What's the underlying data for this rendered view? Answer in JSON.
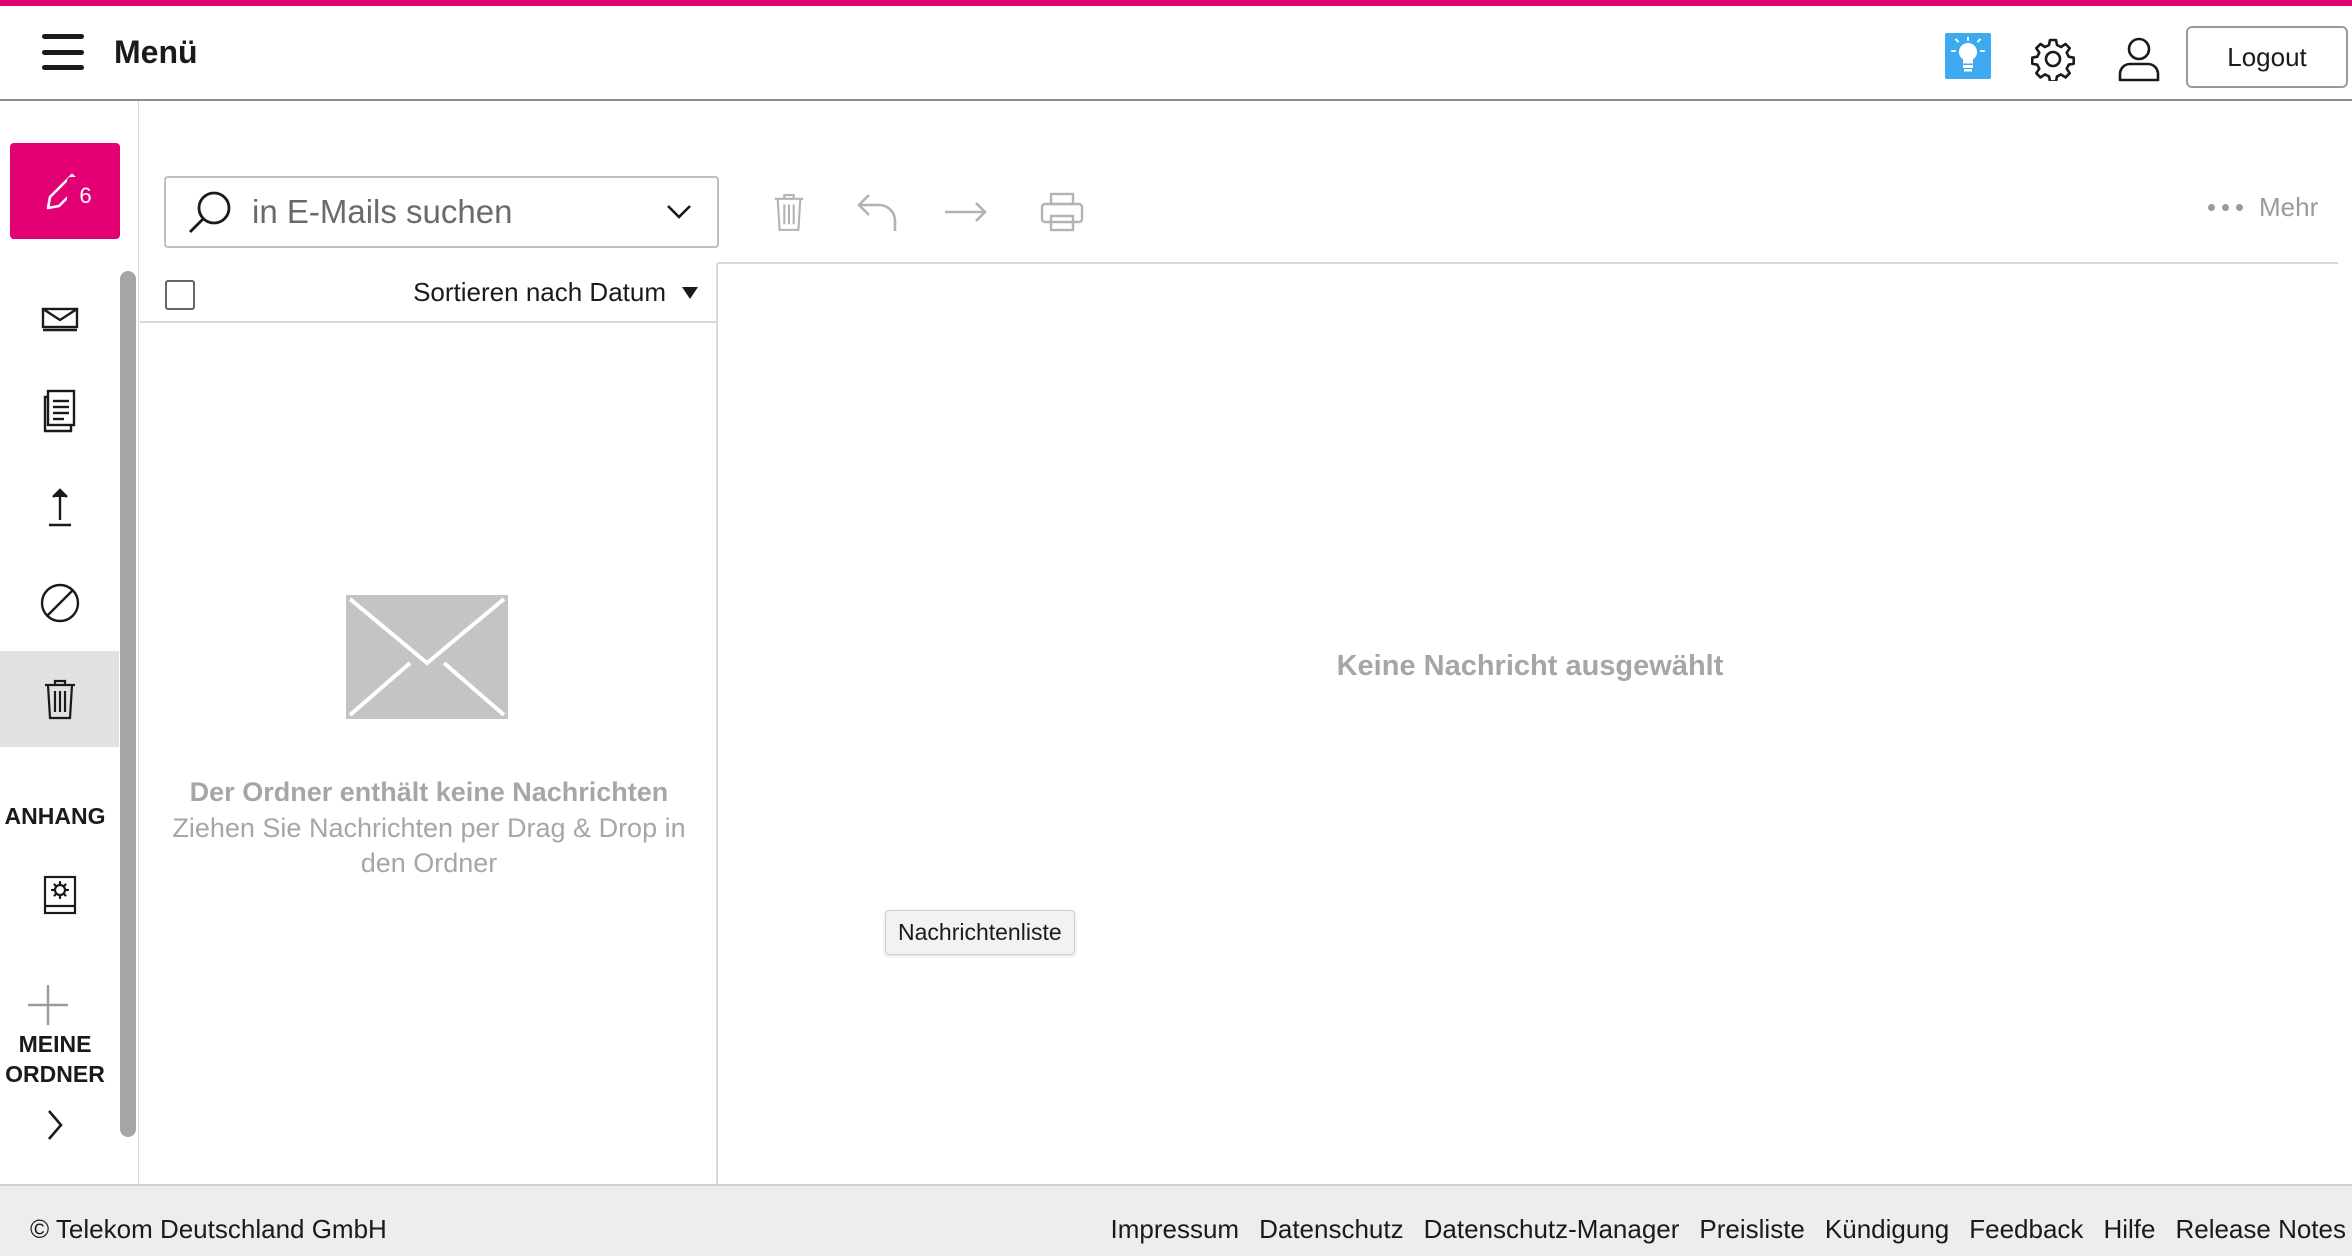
{
  "colors": {
    "brand": "#e20074",
    "accent_bulb": "#3daaf0",
    "muted_text": "#a6a6a6",
    "active_item_bg": "#e1e1e1"
  },
  "header": {
    "menu_label": "Menü",
    "icons": [
      "lightbulb-icon",
      "gear-icon",
      "user-icon"
    ],
    "logout_label": "Logout"
  },
  "sidebar": {
    "compose_icon": "pencil-icon",
    "inbox_badge": "6",
    "items": [
      {
        "name": "inbox",
        "icon": "inbox-icon"
      },
      {
        "name": "drafts",
        "icon": "document-icon"
      },
      {
        "name": "sent",
        "icon": "upload-arrow-icon"
      },
      {
        "name": "spam",
        "icon": "blocked-icon"
      },
      {
        "name": "trash",
        "icon": "trash-icon",
        "active": true
      }
    ],
    "attachment_section": "ANHANG",
    "my_folders_line1": "MEINE",
    "my_folders_line2": "ORDNER"
  },
  "toolbar": {
    "search_placeholder": "in E-Mails suchen",
    "tools": [
      "trash-icon",
      "reply-icon",
      "forward-icon",
      "print-icon"
    ],
    "more_label": "Mehr"
  },
  "message_list": {
    "sort_label": "Sortieren nach Datum",
    "empty_title": "Der Ordner enthält keine Nachrichten",
    "empty_subtitle": "Ziehen Sie Nachrichten per Drag & Drop in den Ordner"
  },
  "reading_pane": {
    "no_message": "Keine Nachricht ausgewählt",
    "tooltip": "Nachrichtenliste"
  },
  "footer": {
    "copyright": "© Telekom Deutschland GmbH",
    "links": [
      "Impressum",
      "Datenschutz",
      "Datenschutz-Manager",
      "Preisliste",
      "Kündigung",
      "Feedback",
      "Hilfe",
      "Release Notes"
    ]
  }
}
